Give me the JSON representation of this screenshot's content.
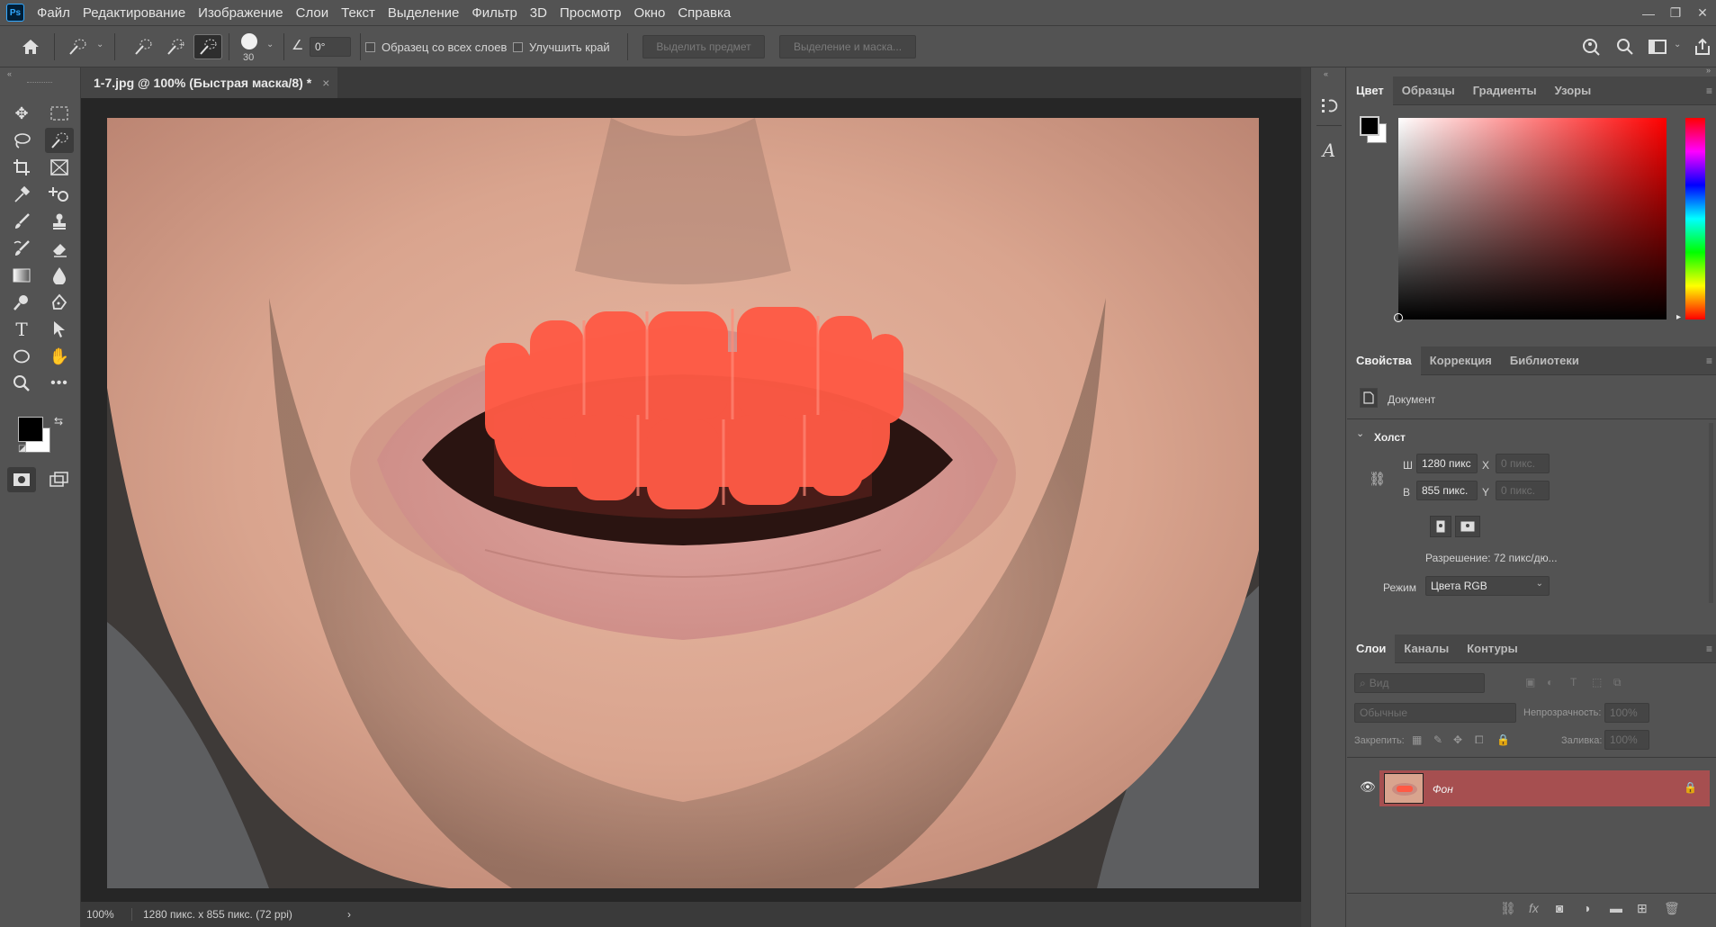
{
  "menu": {
    "logo": "Ps",
    "items": [
      "Файл",
      "Редактирование",
      "Изображение",
      "Слои",
      "Текст",
      "Выделение",
      "Фильтр",
      "3D",
      "Просмотр",
      "Окно",
      "Справка"
    ],
    "window_controls": [
      "minimize-icon",
      "restore-icon",
      "close-icon"
    ]
  },
  "options": {
    "brush_size": "30",
    "angle": "0°",
    "sample_all_layers": "Образец со всех слоев",
    "enhance_edge": "Улучшить край",
    "select_subject": "Выделить предмет",
    "select_and_mask": "Выделение и маска..."
  },
  "document": {
    "tab_title": "1-7.jpg @ 100% (Быстрая маска/8) *",
    "tab_close": "×",
    "zoom": "100%",
    "info": "1280 пикс. x 855 пикс. (72 ppi)",
    "info_arrow": "›"
  },
  "color_panel": {
    "tabs": [
      "Цвет",
      "Образцы",
      "Градиенты",
      "Узоры"
    ],
    "foreground": "#000000",
    "background": "#ffffff",
    "hue_color": "#ff0000"
  },
  "properties_panel": {
    "tabs": [
      "Свойства",
      "Коррекция",
      "Библиотеки"
    ],
    "doc_label": "Документ",
    "canvas_header": "Холст",
    "w_label": "Ш",
    "w_value": "1280 пикс",
    "h_label": "В",
    "h_value": "855 пикс.",
    "x_label": "X",
    "x_value": "0 пикс.",
    "y_label": "Y",
    "y_value": "0 пикс.",
    "resolution": "Разрешение: 72 пикс/дю...",
    "mode_label": "Режим",
    "mode_value": "Цвета RGB"
  },
  "layers_panel": {
    "tabs": [
      "Слои",
      "Каналы",
      "Контуры"
    ],
    "filter_placeholder": "Вид",
    "blend_mode": "Обычные",
    "opacity_label": "Непрозрачность:",
    "opacity_value": "100%",
    "lock_label": "Закрепить:",
    "fill_label": "Заливка:",
    "fill_value": "100%",
    "layer_name": "Фон",
    "layer_row_color": "#a64f50"
  }
}
